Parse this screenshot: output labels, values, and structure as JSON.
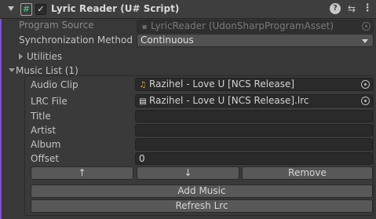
{
  "header": {
    "title": "Lyric Reader (U# Script)",
    "script_icon_glyph": "#",
    "enabled_glyph": "✓",
    "help_glyph": "?",
    "preset_glyph": "⇆",
    "menu_glyph": "⋮"
  },
  "colors": {
    "accent_purple": "#7a4fd0",
    "csharp_green": "#2fbf6e",
    "audio_icon": "#e0b040"
  },
  "program_source": {
    "label": "Program Source",
    "value": "LyricReader (UdonSharpProgramAsset)"
  },
  "sync_method": {
    "label": "Synchronization Method",
    "value": "Continuous"
  },
  "utilities": {
    "label": "Utilities"
  },
  "music_list": {
    "label": "Music List (1)",
    "audio_clip": {
      "label": "Audio Clip",
      "value": "Razihel - Love U [NCS Release]",
      "icon": "music-note-icon"
    },
    "lrc_file": {
      "label": "LRC File",
      "value": "Razihel - Love U [NCS Release].lrc",
      "icon": "text-asset-icon"
    },
    "title": {
      "label": "Title",
      "value": ""
    },
    "artist": {
      "label": "Artist",
      "value": ""
    },
    "album": {
      "label": "Album",
      "value": ""
    },
    "offset": {
      "label": "Offset",
      "value": "0"
    },
    "buttons": {
      "move_up": "↑",
      "move_down": "↓",
      "remove": "Remove"
    }
  },
  "actions": {
    "add_music": "Add Music",
    "refresh_lrc": "Refresh Lrc"
  }
}
